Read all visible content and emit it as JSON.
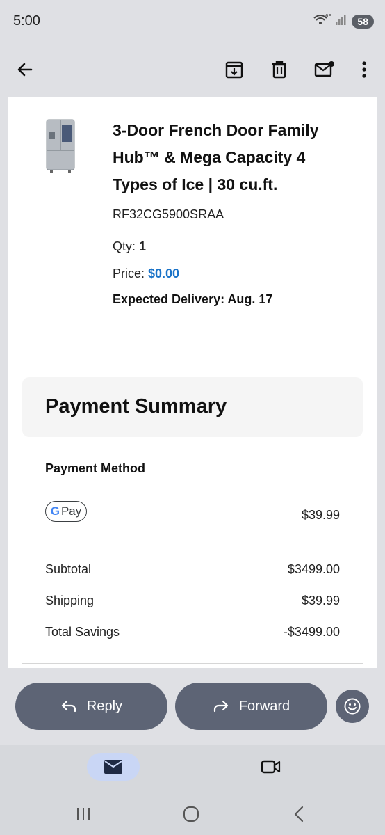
{
  "status": {
    "time": "5:00",
    "network": "6E",
    "battery": "58"
  },
  "product": {
    "title": "3-Door French Door Family Hub™ & Mega Capacity 4 Types of Ice | 30 cu.ft.",
    "sku": "RF32CG5900SRAA",
    "qty_label": "Qty: ",
    "qty_value": "1",
    "price_label": "Price: ",
    "price_value": "$0.00",
    "delivery": "Expected Delivery: Aug. 17"
  },
  "payment": {
    "title": "Payment Summary",
    "method_label": "Payment Method",
    "method_badge_g": "G",
    "method_badge_text": "Pay",
    "method_amount": "$39.99",
    "rows": [
      {
        "label": "Subtotal",
        "value": "$3499.00"
      },
      {
        "label": "Shipping",
        "value": "$39.99"
      },
      {
        "label": "Total Savings",
        "value": "-$3499.00"
      }
    ]
  },
  "actions": {
    "reply": "Reply",
    "forward": "Forward"
  },
  "colors": {
    "accent_price": "#1a73c8",
    "pill_bg": "#5d6475",
    "mail_tab_bg": "#c9d6f5"
  },
  "icons": [
    "back-arrow-icon",
    "archive-icon",
    "trash-icon",
    "mark-unread-icon",
    "more-vert-icon",
    "reply-icon",
    "forward-icon",
    "emoji-icon",
    "mail-icon",
    "video-icon"
  ]
}
